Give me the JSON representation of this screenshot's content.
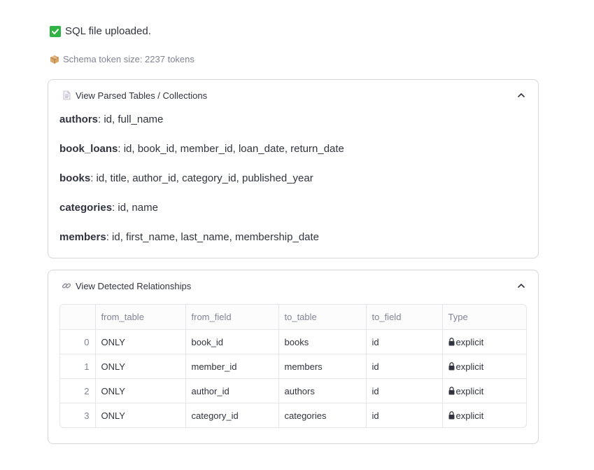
{
  "status": {
    "upload_message": "SQL file uploaded.",
    "token_message": "Schema token size: 2237 tokens"
  },
  "tables_expander": {
    "title": "View Parsed Tables / Collections",
    "tables": [
      {
        "name": "authors",
        "fields": ": id, full_name"
      },
      {
        "name": "book_loans",
        "fields": ": id, book_id, member_id, loan_date, return_date"
      },
      {
        "name": "books",
        "fields": ": id, title, author_id, category_id, published_year"
      },
      {
        "name": "categories",
        "fields": ": id, name"
      },
      {
        "name": "members",
        "fields": ": id, first_name, last_name, membership_date"
      }
    ]
  },
  "relationships_expander": {
    "title": "View Detected Relationships",
    "columns": [
      "from_table",
      "from_field",
      "to_table",
      "to_field",
      "Type"
    ],
    "rows": [
      {
        "index": "0",
        "from_table": "ONLY",
        "from_field": "book_id",
        "to_table": "books",
        "to_field": "id",
        "type": "explicit"
      },
      {
        "index": "1",
        "from_table": "ONLY",
        "from_field": "member_id",
        "to_table": "members",
        "to_field": "id",
        "type": "explicit"
      },
      {
        "index": "2",
        "from_table": "ONLY",
        "from_field": "author_id",
        "to_table": "authors",
        "to_field": "id",
        "type": "explicit"
      },
      {
        "index": "3",
        "from_table": "ONLY",
        "from_field": "category_id",
        "to_table": "categories",
        "to_field": "id",
        "type": "explicit"
      }
    ]
  },
  "icons": {
    "upload_status": "check-mark-icon",
    "token_size": "package-icon",
    "tables_header": "document-icon",
    "relationships_header": "link-icon",
    "expander_toggle": "chevron-up-icon",
    "relationship_type": "lock-icon"
  },
  "colors": {
    "success": "#2fb344",
    "muted_text": "#808495",
    "border": "#d6d6d9"
  }
}
